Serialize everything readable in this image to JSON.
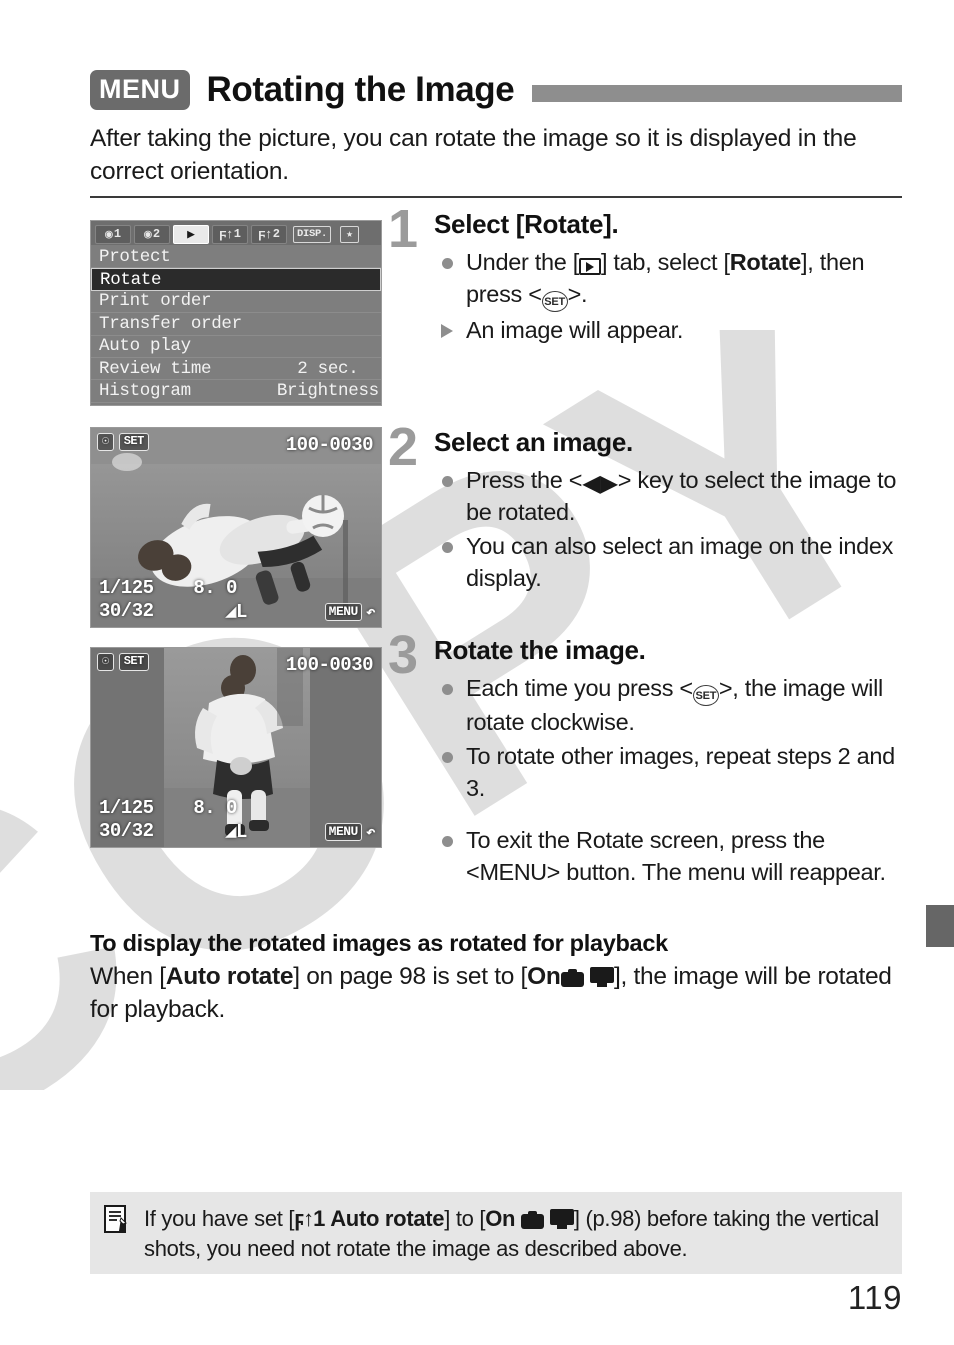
{
  "header": {
    "menu_chip": "MENU",
    "title": "Rotating the Image"
  },
  "intro": "After taking the picture, you can rotate the image so it is displayed in the correct orientation.",
  "camera_menu": {
    "tabs": [
      {
        "name": "shoot-1",
        "glyph": "◉",
        "num": "1",
        "active": false
      },
      {
        "name": "shoot-2",
        "glyph": "◉",
        "num": "2",
        "active": false
      },
      {
        "name": "playback",
        "glyph": "▶",
        "num": "",
        "active": true
      },
      {
        "name": "setup-1",
        "glyph": "Ψ",
        "num": "1",
        "active": false
      },
      {
        "name": "setup-2",
        "glyph": "Ψ",
        "num": "2",
        "active": false
      }
    ],
    "disp_chip": "DISP.",
    "star_chip": "★",
    "rows": [
      {
        "label": "Protect",
        "value": "",
        "selected": false
      },
      {
        "label": "Rotate",
        "value": "",
        "selected": true
      },
      {
        "label": "Print order",
        "value": "",
        "selected": false
      },
      {
        "label": "Transfer order",
        "value": "",
        "selected": false
      },
      {
        "label": "Auto play",
        "value": "",
        "selected": false
      },
      {
        "label": "Review time",
        "value": "2 sec.",
        "selected": false
      },
      {
        "label": "Histogram",
        "value": "Brightness",
        "selected": false
      }
    ]
  },
  "lcd_image": {
    "protect_badge": "☉",
    "set_badge": "SET",
    "file_number": "100-0030",
    "shutter_speed": "1/125",
    "aperture": "8. 0",
    "frame_count": "30/32",
    "quality": "L",
    "menu_chip": "MENU",
    "return_arrow": "↶"
  },
  "steps": [
    {
      "number": "1",
      "title": "Select [Rotate].",
      "bullets": [
        {
          "marker": "dot",
          "text_before": "Under the [",
          "icon": "playback-icon",
          "text_after": "] tab, select [Rotate], then press <SET>."
        },
        {
          "marker": "triangle",
          "text_before": "An image will appear.",
          "icon": "",
          "text_after": ""
        }
      ]
    },
    {
      "number": "2",
      "title": "Select an image.",
      "bullets": [
        {
          "marker": "dot",
          "text_before": "Press the <",
          "icon": "left-right-key-icon",
          "text_after": "> key to select the image to be rotated."
        },
        {
          "marker": "dot",
          "text_before": "You can also select an image on the index display.",
          "icon": "",
          "text_after": ""
        }
      ]
    },
    {
      "number": "3",
      "title": "Rotate the image.",
      "bullets": [
        {
          "marker": "dot",
          "text_before": "Each time you press <SET>, the image will rotate clockwise.",
          "icon": "",
          "text_after": ""
        },
        {
          "marker": "dot",
          "text_before": "To rotate other images, repeat steps 2 and 3.",
          "icon": "",
          "text_after": ""
        },
        {
          "marker": "dot",
          "text_before": "To exit the Rotate screen, press the <MENU> button. The menu will reappear.",
          "icon": "",
          "text_after": ""
        }
      ]
    }
  ],
  "playback_section": {
    "heading": "To display the rotated images as rotated for playback",
    "body_part_1": "When [",
    "body_bold_1": "Auto rotate",
    "body_part_2": "] on page 98 is set to [",
    "body_bold_2": "On",
    "body_part_3": "], the image will be rotated for playback."
  },
  "note": {
    "icon": "note-pencil-icon",
    "part_1": "If you have set [",
    "bold_1": "Auto rotate",
    "part_2": "] to [",
    "bold_2": "On",
    "part_3": "] (p.98) before taking the vertical shots, you need not rotate the image as described above."
  },
  "page_number": "119",
  "colors": {
    "accent_gray": "#8e8e8e",
    "menu_chip_bg": "#6b6b6b",
    "note_bg": "#e6e6e6",
    "lcd_bg": "#7e7e7e",
    "selected_row": "#2b2b2b",
    "side_tab": "#666666"
  }
}
